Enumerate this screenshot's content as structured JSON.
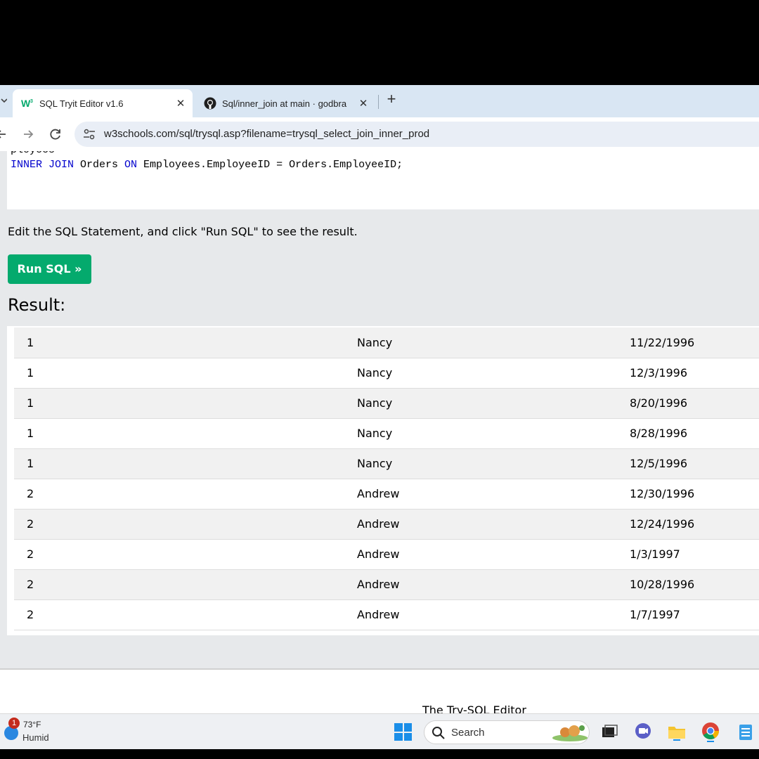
{
  "browser": {
    "tabs": [
      {
        "title": "SQL Tryit Editor v1.6",
        "close": "✕",
        "favicon": "w3schools-icon"
      },
      {
        "title": "Sql/inner_join at main · godbra",
        "close": "✕",
        "favicon": "github-icon"
      }
    ],
    "new_tab": "+",
    "url": "w3schools.com/sql/trysql.asp?filename=trysql_select_join_inner_prod"
  },
  "editor": {
    "code_line_cut": "     ployees",
    "code_kw_inner_join": "INNER JOIN",
    "code_orders": " Orders ",
    "code_kw_on": "ON",
    "code_rest": " Employees.EmployeeID = Orders.EmployeeID;"
  },
  "instruction": "Edit the SQL Statement, and click \"Run SQL\" to see the result.",
  "run_button": "Run SQL »",
  "result_label": "Result:",
  "rows": [
    [
      "1",
      "Nancy",
      "11/22/1996"
    ],
    [
      "1",
      "Nancy",
      "12/3/1996"
    ],
    [
      "1",
      "Nancy",
      "8/20/1996"
    ],
    [
      "1",
      "Nancy",
      "8/28/1996"
    ],
    [
      "1",
      "Nancy",
      "12/5/1996"
    ],
    [
      "2",
      "Andrew",
      "12/30/1996"
    ],
    [
      "2",
      "Andrew",
      "12/24/1996"
    ],
    [
      "2",
      "Andrew",
      "1/3/1997"
    ],
    [
      "2",
      "Andrew",
      "10/28/1996"
    ],
    [
      "2",
      "Andrew",
      "1/7/1997"
    ]
  ],
  "footer_text": "The Try-SQL Editor",
  "taskbar": {
    "badge": "1",
    "temp": "73°F",
    "condition": "Humid",
    "search_placeholder": "Search"
  },
  "colors": {
    "run_button": "#04aa6d",
    "sql_keyword": "#0000cd",
    "tabstrip": "#d9e6f3"
  }
}
